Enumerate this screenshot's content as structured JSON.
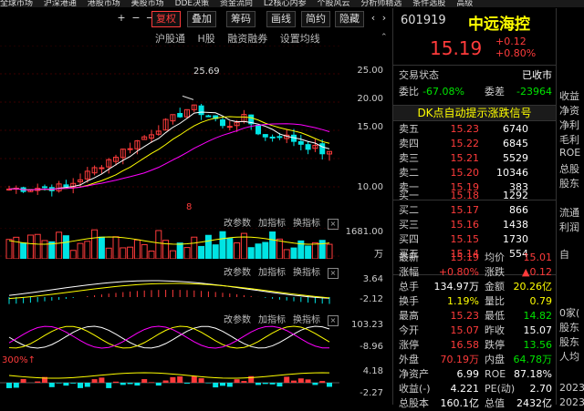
{
  "menu": [
    "全球市场",
    "沪深港通",
    "港股市场",
    "美股市场",
    "DDE决策",
    "资金流向",
    "L2核心内参",
    "个股风云",
    "分析师精选",
    "条件选股",
    "高级"
  ],
  "toolbar": {
    "plus": "+",
    "minus": "−",
    "arrow": "→",
    "fuquan": "复权",
    "diejia": "叠加",
    "chouma": "筹码",
    "huaxian": "画线",
    "jianyue": "简约",
    "yincang": "隐藏"
  },
  "subbar": {
    "hugutong": "沪股通",
    "hgu": "H股",
    "rongzi": "融资融券",
    "junxian": "设置均线"
  },
  "main_chart": {
    "high_label": "25.69",
    "axis": [
      "25.00",
      "20.00",
      "15.00",
      "10.00"
    ],
    "marker": "8"
  },
  "panels": [
    {
      "btn1": "改参数",
      "btn2": "加指标",
      "btn3": "换指标",
      "axis_top": "1681.00",
      "axis_bottom": "万"
    },
    {
      "btn1": "改参数",
      "btn2": "加指标",
      "btn3": "换指标",
      "axis_top": "3.64",
      "axis_bottom": "-2.12"
    },
    {
      "btn1": "改参数",
      "btn2": "加指标",
      "btn3": "换指标",
      "axis_top": "103.23",
      "axis_bottom": "-8.96"
    },
    {
      "label": "300%↑",
      "axis_top": "4.18",
      "axis_bottom": "-2.27"
    }
  ],
  "quote": {
    "code": "601919",
    "name": "中远海控",
    "price": "15.19",
    "change": "+0.12",
    "change_pct": "+0.80%",
    "status_label": "交易状态",
    "status_value": "已收市",
    "weibi_label": "委比",
    "weibi_value": "-67.08%",
    "weicha_label": "委差",
    "weicha_value": "-23964",
    "dk_signal": "DK点自动提示涨跌信号",
    "sell": [
      {
        "label": "卖五",
        "price": "15.23",
        "vol": "6740"
      },
      {
        "label": "卖四",
        "price": "15.22",
        "vol": "6845"
      },
      {
        "label": "卖三",
        "price": "15.21",
        "vol": "5529"
      },
      {
        "label": "卖二",
        "price": "15.20",
        "vol": "10346"
      },
      {
        "label": "卖一",
        "price": "15.19",
        "vol": "383"
      }
    ],
    "buy": [
      {
        "label": "买一",
        "price": "15.18",
        "vol": "1292"
      },
      {
        "label": "买二",
        "price": "15.17",
        "vol": "866"
      },
      {
        "label": "买三",
        "price": "15.16",
        "vol": "1438"
      },
      {
        "label": "买四",
        "price": "15.15",
        "vol": "1730"
      },
      {
        "label": "买五",
        "price": "15.14",
        "vol": "554"
      }
    ],
    "stats": [
      {
        "l1": "最新",
        "v1": "15.19",
        "l2": "均价",
        "v2": "15.01"
      },
      {
        "l1": "涨幅",
        "v1": "+0.80%",
        "l2": "涨跌",
        "v2": "▲0.12"
      },
      {
        "l1": "总手",
        "v1": "134.97万",
        "l2": "金额",
        "v2": "20.26亿"
      },
      {
        "l1": "换手",
        "v1": "1.19%",
        "l2": "量比",
        "v2": "0.79"
      },
      {
        "l1": "最高",
        "v1": "15.23",
        "l2": "最低",
        "v2": "14.82"
      },
      {
        "l1": "今开",
        "v1": "15.07",
        "l2": "昨收",
        "v2": "15.07"
      },
      {
        "l1": "涨停",
        "v1": "16.58",
        "l2": "跌停",
        "v2": "13.56"
      },
      {
        "l1": "外盘",
        "v1": "70.19万",
        "l2": "内盘",
        "v2": "64.78万"
      },
      {
        "l1": "净资产",
        "v1": "6.99",
        "l2": "ROE",
        "v2": "87.18%"
      },
      {
        "l1": "收益(-)",
        "v1": "4.221",
        "l2": "PE(动)",
        "v2": "2.70"
      },
      {
        "l1": "总股本",
        "v1": "160.1亿",
        "l2": "总值",
        "v2": "2432亿"
      }
    ]
  },
  "far_right": [
    "收益",
    "净资",
    "净利",
    "毛利",
    "ROE",
    "总股",
    "股东",
    "流通",
    "利润",
    "自",
    "0家(",
    "股东",
    "股东",
    "人均",
    "2023",
    "2023"
  ],
  "colors": {
    "up": "#ff3b3b",
    "down": "#00e4e4",
    "ma5": "#ffffff",
    "ma10": "#ffff00",
    "ma20": "#ff00ff"
  }
}
